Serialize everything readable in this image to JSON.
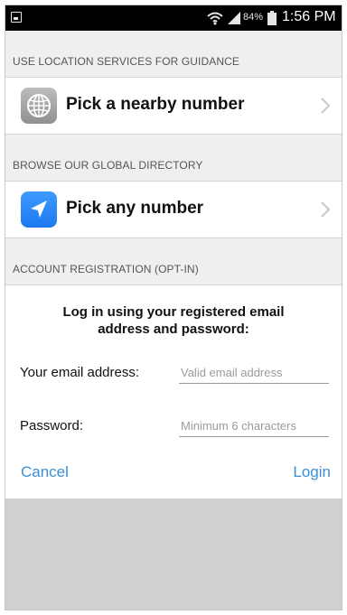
{
  "status_bar": {
    "battery_percent": "84%",
    "time": "1:56 PM",
    "icons": [
      "notification-icon",
      "wifi-icon",
      "signal-icon",
      "battery-icon"
    ]
  },
  "sections": [
    {
      "header": "USE LOCATION SERVICES FOR GUIDANCE",
      "item_label": "Pick a nearby number",
      "icon": "globe-icon"
    },
    {
      "header": "BROWSE OUR GLOBAL DIRECTORY",
      "item_label": "Pick any number",
      "icon": "navigation-arrow-icon"
    },
    {
      "header": "ACCOUNT REGISTRATION (OPT-IN)"
    }
  ],
  "login": {
    "title_line1": "Log in using your registered email",
    "title_line2": "address and password:",
    "email_label": "Your email address:",
    "email_placeholder": "Valid email address",
    "email_value": "",
    "password_label": "Password:",
    "password_placeholder": "Minimum 6 characters",
    "password_value": "",
    "cancel_label": "Cancel",
    "login_label": "Login"
  },
  "colors": {
    "accent": "#3a8fd6",
    "section_bg": "#efefef",
    "nav_icon_blue": "#2a86f5",
    "globe_icon_gray": "#a6a6a6",
    "background": "#d0d0d0"
  }
}
